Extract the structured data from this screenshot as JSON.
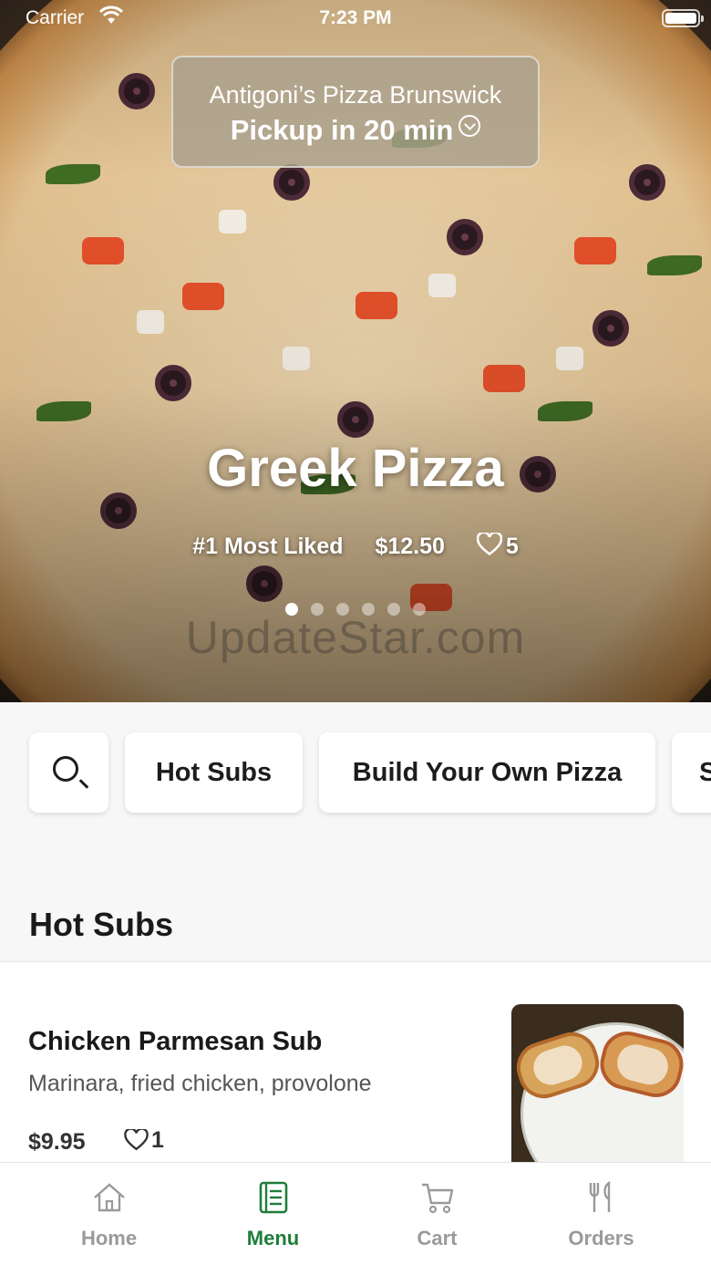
{
  "status_bar": {
    "carrier": "Carrier",
    "time": "7:23 PM"
  },
  "location": {
    "name": "Antigoni’s Pizza Brunswick",
    "pickup": "Pickup in 20 min"
  },
  "featured": {
    "title": "Greek Pizza",
    "badge": "#1 Most Liked",
    "price": "$12.50",
    "likes": "5",
    "carousel_pages": 6,
    "carousel_active_index": 0
  },
  "watermark": "UpdateStar.com",
  "categories": [
    {
      "label": "Hot Subs"
    },
    {
      "label": "Build Your Own Pizza"
    },
    {
      "label": "S"
    }
  ],
  "section": {
    "title": "Hot Subs"
  },
  "menu_items": [
    {
      "name": "Chicken Parmesan Sub",
      "description": "Marinara, fried chicken, provolone",
      "price": "$9.95",
      "likes": "1"
    }
  ],
  "tabs": [
    {
      "label": "Home",
      "icon": "home-icon",
      "active": false
    },
    {
      "label": "Menu",
      "icon": "menu-book-icon",
      "active": true
    },
    {
      "label": "Cart",
      "icon": "cart-icon",
      "active": false
    },
    {
      "label": "Orders",
      "icon": "fork-knife-icon",
      "active": false
    }
  ],
  "colors": {
    "accent": "#1e7d3a",
    "inactive_tab": "#9a9a9a"
  }
}
